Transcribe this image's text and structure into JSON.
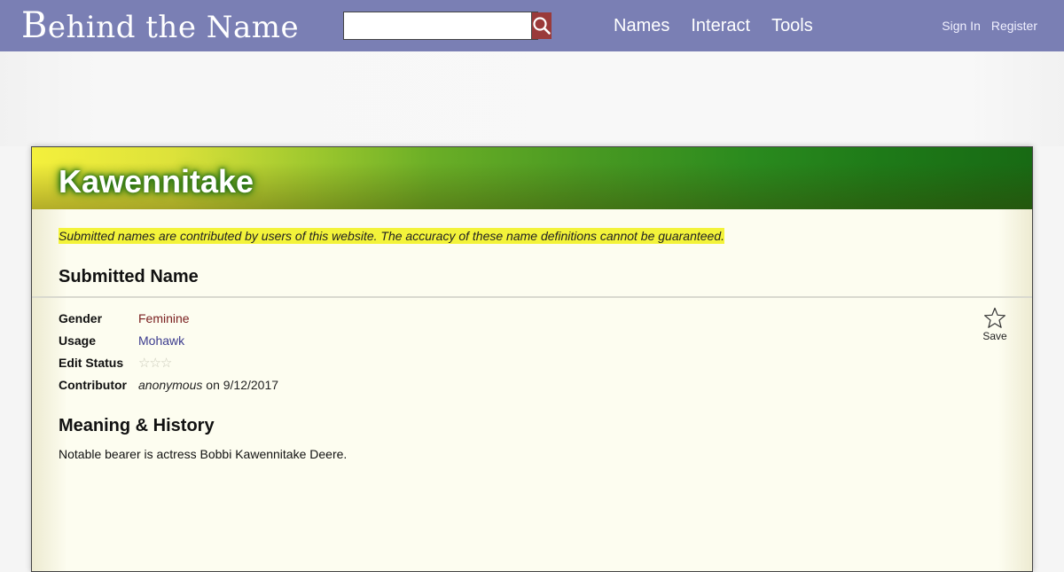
{
  "header": {
    "logo": {
      "cap": "B",
      "rest": "ehind the Name"
    },
    "search": {
      "value": "",
      "icon": "search-icon"
    },
    "nav": [
      {
        "label": "Names"
      },
      {
        "label": "Interact"
      },
      {
        "label": "Tools"
      }
    ],
    "account": {
      "sign_in": "Sign In",
      "register": "Register"
    },
    "colors": {
      "bar": "#7a7fb4",
      "search_button": "#9a3a3a"
    }
  },
  "name": {
    "title": "Kawennitake",
    "disclaimer": "Submitted names are contributed by users of this website. The accuracy of these name definitions cannot be guaranteed.",
    "save_label": "Save",
    "save_icon": "star-outline-icon"
  },
  "submitted": {
    "heading": "Submitted Name",
    "rows": {
      "gender": {
        "label": "Gender",
        "value": "Feminine"
      },
      "usage": {
        "label": "Usage",
        "value": "Mohawk"
      },
      "edit_status": {
        "label": "Edit Status",
        "stars": "☆☆☆",
        "rating": 0,
        "max": 3
      },
      "contributor": {
        "label": "Contributor",
        "name": "anonymous",
        "suffix": " on 9/12/2017"
      }
    }
  },
  "meaning": {
    "heading": "Meaning & History",
    "text": "Notable bearer is actress Bobbi Kawennitake Deere."
  }
}
